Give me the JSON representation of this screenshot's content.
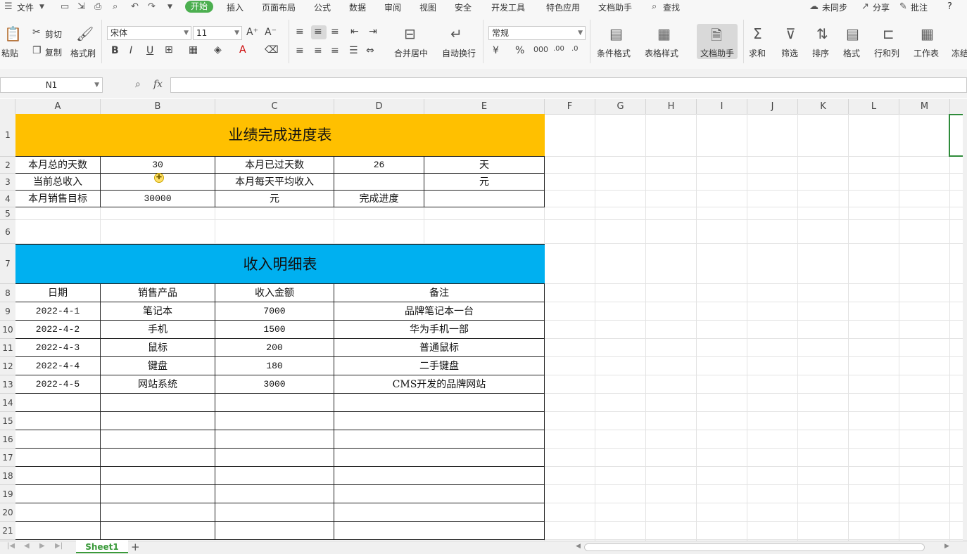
{
  "menu": {
    "file": "文件",
    "tabs": [
      "开始",
      "插入",
      "页面布局",
      "公式",
      "数据",
      "审阅",
      "视图",
      "安全",
      "开发工具",
      "特色应用",
      "文档助手"
    ],
    "search": "查找",
    "sync": "未同步",
    "share": "分享",
    "comment": "批注",
    "help": "?"
  },
  "ribbon": {
    "paste": "粘贴",
    "cut": "剪切",
    "copy": "复制",
    "format_painter": "格式刷",
    "font_name": "宋体",
    "font_size": "11",
    "bold": "B",
    "italic": "I",
    "underline": "U",
    "merge_center": "合并居中",
    "wrap": "自动换行",
    "number_format": "常规",
    "conditional_format": "条件格式",
    "table_style": "表格样式",
    "doc_helper": "文档助手",
    "sum": "求和",
    "filter": "筛选",
    "sort": "排序",
    "format": "格式",
    "row_col": "行和列",
    "worksheet": "工作表",
    "freeze": "冻结"
  },
  "formula_bar": {
    "name_box": "N1",
    "fx": "fx",
    "value": ""
  },
  "columns": [
    "A",
    "B",
    "C",
    "D",
    "E",
    "F",
    "G",
    "H",
    "I",
    "J",
    "K",
    "L",
    "M"
  ],
  "rows": [
    "1",
    "2",
    "3",
    "4",
    "5",
    "6",
    "7",
    "8",
    "9",
    "10",
    "11",
    "12",
    "13",
    "14",
    "15",
    "16",
    "17",
    "18",
    "19",
    "20",
    "21"
  ],
  "colors": {
    "title1_bg": "#ffc000",
    "title2_bg": "#00b0f0",
    "active_tab": "#4caf50"
  },
  "sheet": {
    "title1": "业绩完成进度表",
    "r2": [
      "本月总的天数",
      "30",
      "本月已过天数",
      "26",
      "天"
    ],
    "r3": [
      "当前总收入",
      "",
      "本月每天平均收入",
      "",
      "元"
    ],
    "r4": [
      "本月销售目标",
      "30000",
      "元",
      "完成进度",
      ""
    ],
    "title2": "收入明细表",
    "header": [
      "日期",
      "销售产品",
      "收入金额",
      "备注"
    ],
    "detail": [
      [
        "2022-4-1",
        "笔记本",
        "7000",
        "品牌笔记本一台"
      ],
      [
        "2022-4-2",
        "手机",
        "1500",
        "华为手机一部"
      ],
      [
        "2022-4-3",
        "鼠标",
        "200",
        "普通鼠标"
      ],
      [
        "2022-4-4",
        "键盘",
        "180",
        "二手键盘"
      ],
      [
        "2022-4-5",
        "网站系统",
        "3000",
        "CMS开发的品牌网站"
      ]
    ]
  },
  "tabs": {
    "sheet1": "Sheet1",
    "add": "+"
  }
}
